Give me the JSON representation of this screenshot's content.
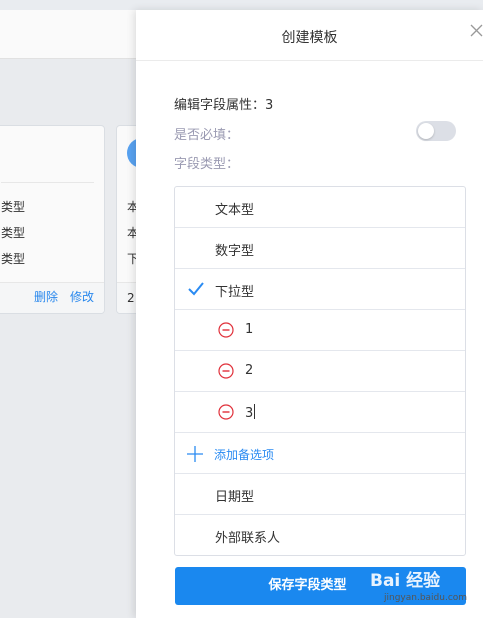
{
  "background": {
    "card1": {
      "rows": [
        "类型",
        "类型",
        "类型"
      ],
      "actions": {
        "delete": "删除",
        "edit": "修改"
      }
    },
    "card2": {
      "rows": [
        "本",
        "本",
        "下"
      ],
      "footer": "2"
    }
  },
  "modal": {
    "title": "创建模板",
    "field_title": "编辑字段属性：3",
    "required_label": "是否必填：",
    "required_on": false,
    "type_label": "字段类型：",
    "types": {
      "text": "文本型",
      "number": "数字型",
      "dropdown": "下拉型",
      "date": "日期型",
      "contact": "外部联系人"
    },
    "selected_type": "dropdown",
    "options": [
      "1",
      "2",
      "3"
    ],
    "add_option": "添加备选项",
    "save_button": "保存字段类型"
  },
  "watermark": {
    "brand": "Bai 经验",
    "url": "jingyan.baidu.com"
  },
  "colors": {
    "accent": "#1a88ef",
    "danger": "#e0303a",
    "muted": "#9a9ab2"
  }
}
